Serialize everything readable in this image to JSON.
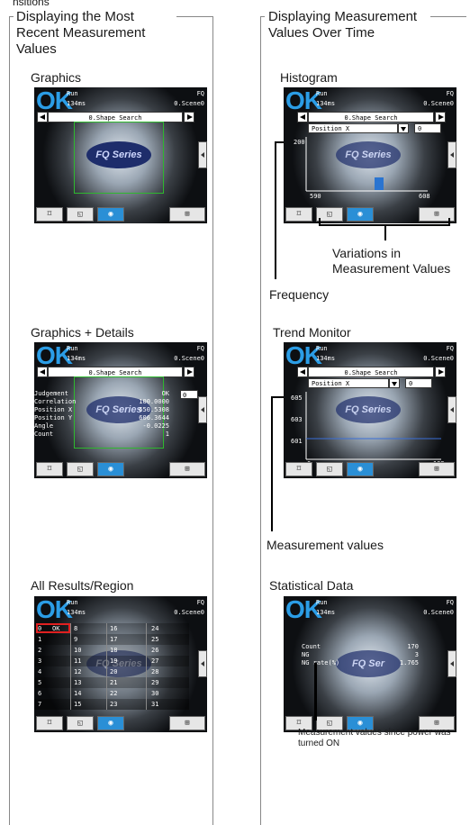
{
  "top_fragment": "nsitions",
  "left": {
    "heading": "Displaying the Most Recent Measurement Values",
    "sections": [
      {
        "label": "Graphics"
      },
      {
        "label": "Graphics + Details"
      },
      {
        "label": "All Results/Region"
      }
    ]
  },
  "right": {
    "heading": "Displaying Measurement Values Over Time",
    "sections": [
      {
        "label": "Histogram"
      },
      {
        "label": "Trend Monitor"
      },
      {
        "label": "Statistical Data"
      }
    ],
    "annotations": {
      "variations": "Variations in Measurement Values",
      "frequency": "Frequency",
      "measurement_values": "Measurement values",
      "since_power": "Measurement values since power was turned ON"
    }
  },
  "screen": {
    "ok": "OK",
    "run": "Run",
    "time": "134ms",
    "fq": "FQ",
    "scene": "0.Scene0",
    "scene_short": "0.Scene0",
    "tool": "0.Shape Search",
    "position": "Position X",
    "zero": "0",
    "label": "FQ Series",
    "label_partial": "FQ Ser",
    "toolbar_camera": "◉",
    "toolbar_tool": "⊞"
  },
  "details": {
    "rows": [
      {
        "name": "Judgement",
        "value": "OK"
      },
      {
        "name": "Correlation",
        "value": "100.0000"
      },
      {
        "name": "Position X",
        "value": "650.5308"
      },
      {
        "name": "Position Y",
        "value": "606.3644"
      },
      {
        "name": "Angle",
        "value": "-0.0225"
      },
      {
        "name": "Count",
        "value": "1"
      }
    ]
  },
  "histogram": {
    "y_top": "200",
    "x_min": "590",
    "x_max": "608"
  },
  "trend": {
    "y": [
      "605",
      "603",
      "601"
    ],
    "x_min": "0",
    "x_max": "199"
  },
  "stats": {
    "count_label": "Count",
    "count": "170",
    "ng_label": "NG",
    "ng": "3",
    "rate_label": "NG rate(%)",
    "rate": "1.765"
  },
  "all_results": {
    "col1": [
      "0",
      "1",
      "2",
      "3",
      "4",
      "5",
      "6",
      "7"
    ],
    "col2": [
      "8",
      "9",
      "10",
      "11",
      "12",
      "13",
      "14",
      "15"
    ],
    "col3": [
      "16",
      "17",
      "18",
      "19",
      "20",
      "21",
      "22",
      "23"
    ],
    "col4": [
      "24",
      "25",
      "26",
      "27",
      "28",
      "29",
      "30",
      "31"
    ],
    "first_status": "OK"
  }
}
